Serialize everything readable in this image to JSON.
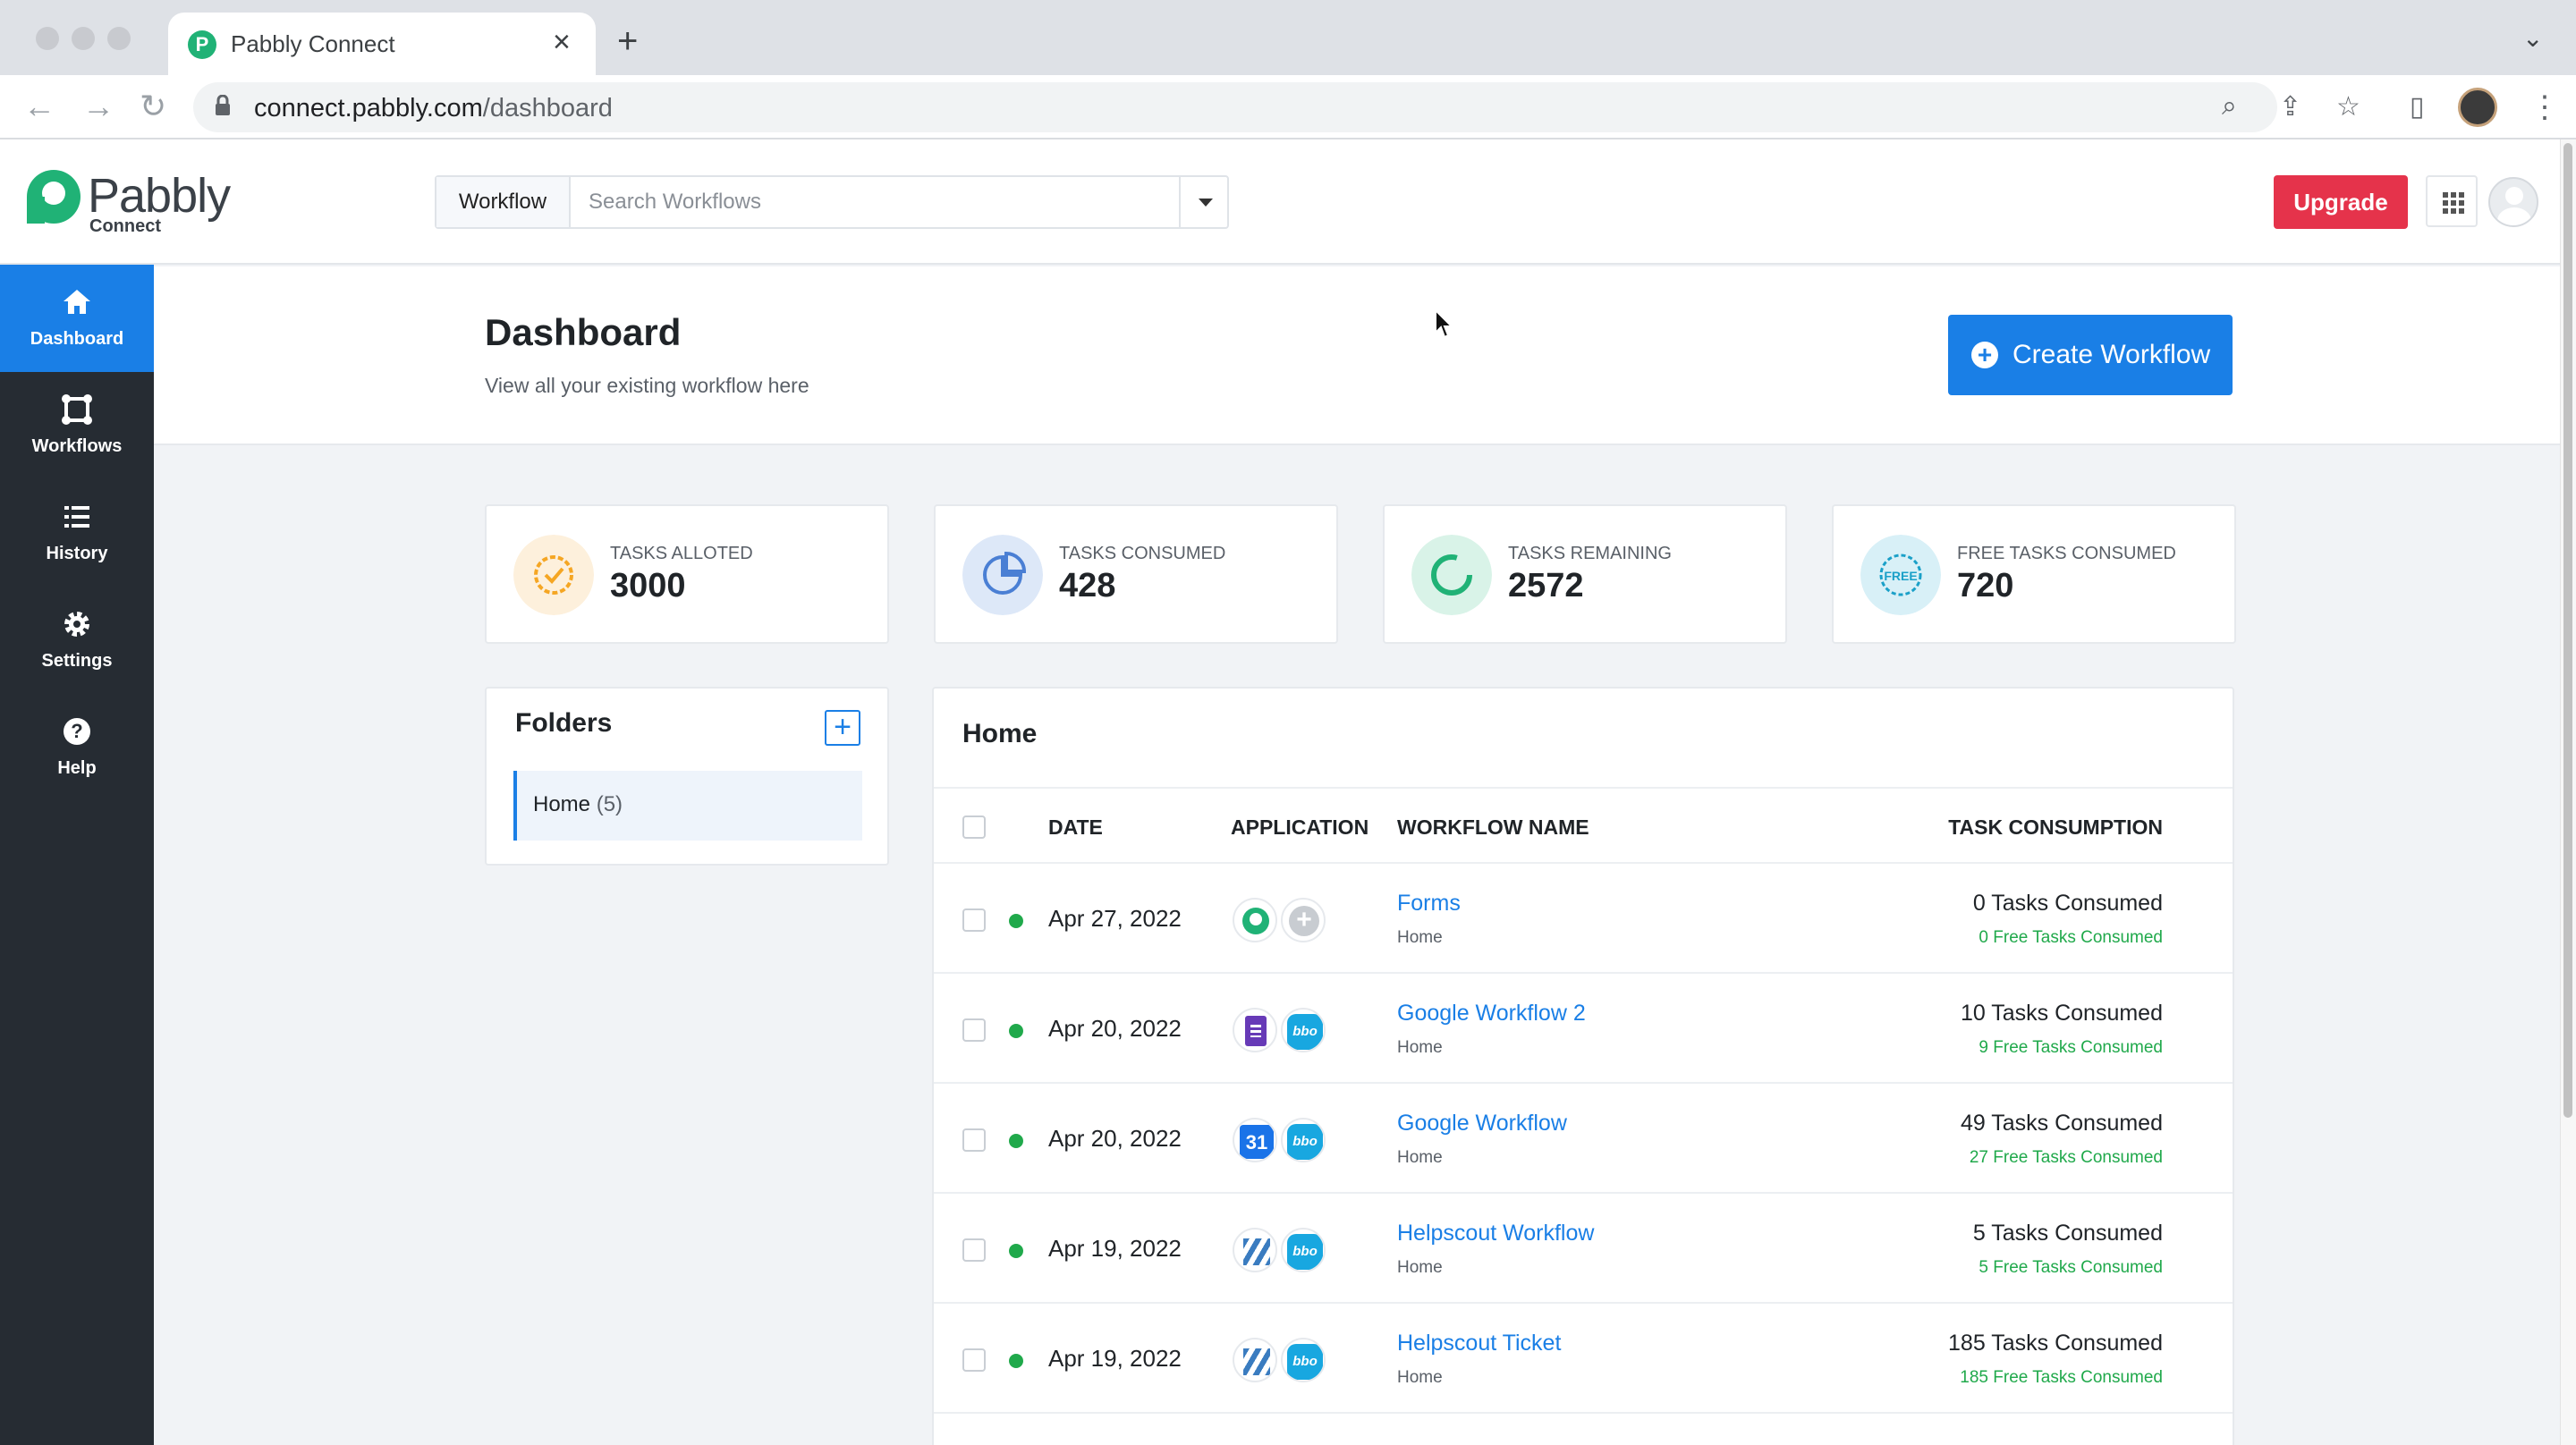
{
  "browser": {
    "tab_title": "Pabbly Connect",
    "url_host": "connect.pabbly.com",
    "url_path": "/dashboard"
  },
  "header": {
    "logo_text": "Pabbly",
    "logo_sub": "Connect",
    "search_scope": "Workflow",
    "search_placeholder": "Search Workflows",
    "upgrade_label": "Upgrade"
  },
  "sidebar": {
    "items": [
      {
        "label": "Dashboard",
        "icon": "home-icon"
      },
      {
        "label": "Workflows",
        "icon": "workflows-icon"
      },
      {
        "label": "History",
        "icon": "history-icon"
      },
      {
        "label": "Settings",
        "icon": "gear-icon"
      },
      {
        "label": "Help",
        "icon": "help-icon"
      }
    ]
  },
  "page": {
    "title": "Dashboard",
    "subtitle": "View all your existing workflow here",
    "create_label": "Create Workflow"
  },
  "stats": [
    {
      "label": "Tasks Alloted",
      "value": "3000",
      "color": "#f5a623"
    },
    {
      "label": "Tasks Consumed",
      "value": "428",
      "color": "#4a7fd4"
    },
    {
      "label": "Tasks Remaining",
      "value": "2572",
      "color": "#20b276"
    },
    {
      "label": "Free Tasks Consumed",
      "value": "720",
      "color": "#1aa0c8"
    }
  ],
  "folders": {
    "title": "Folders",
    "items": [
      {
        "name": "Home",
        "count": "(5)"
      }
    ]
  },
  "workflows": {
    "title": "Home",
    "columns": [
      "DATE",
      "APPLICATION",
      "WORKFLOW NAME",
      "TASK CONSUMPTION"
    ],
    "rows": [
      {
        "date": "Apr 27, 2022",
        "apps": [
          "pabbly-icon",
          "plus-icon"
        ],
        "name": "Forms",
        "folder": "Home",
        "tasks": "0 Tasks Consumed",
        "free": "0 Free Tasks Consumed"
      },
      {
        "date": "Apr 20, 2022",
        "apps": [
          "google-forms-icon",
          "app-icon"
        ],
        "name": "Google Workflow 2",
        "folder": "Home",
        "tasks": "10 Tasks Consumed",
        "free": "9 Free Tasks Consumed"
      },
      {
        "date": "Apr 20, 2022",
        "apps": [
          "google-calendar-icon",
          "app-icon"
        ],
        "name": "Google Workflow",
        "folder": "Home",
        "tasks": "49 Tasks Consumed",
        "free": "27 Free Tasks Consumed"
      },
      {
        "date": "Apr 19, 2022",
        "apps": [
          "helpscout-icon",
          "app-icon"
        ],
        "name": "Helpscout Workflow",
        "folder": "Home",
        "tasks": "5 Tasks Consumed",
        "free": "5 Free Tasks Consumed"
      },
      {
        "date": "Apr 19, 2022",
        "apps": [
          "helpscout-icon",
          "app-icon"
        ],
        "name": "Helpscout Ticket",
        "folder": "Home",
        "tasks": "185 Tasks Consumed",
        "free": "185 Free Tasks Consumed"
      }
    ],
    "calendar_day": "31",
    "app_badge": "bbo"
  },
  "colors": {
    "accent": "#1a7fe6",
    "sidebar_bg": "#262c33",
    "upgrade": "#e5334b",
    "success": "#20a94b"
  }
}
